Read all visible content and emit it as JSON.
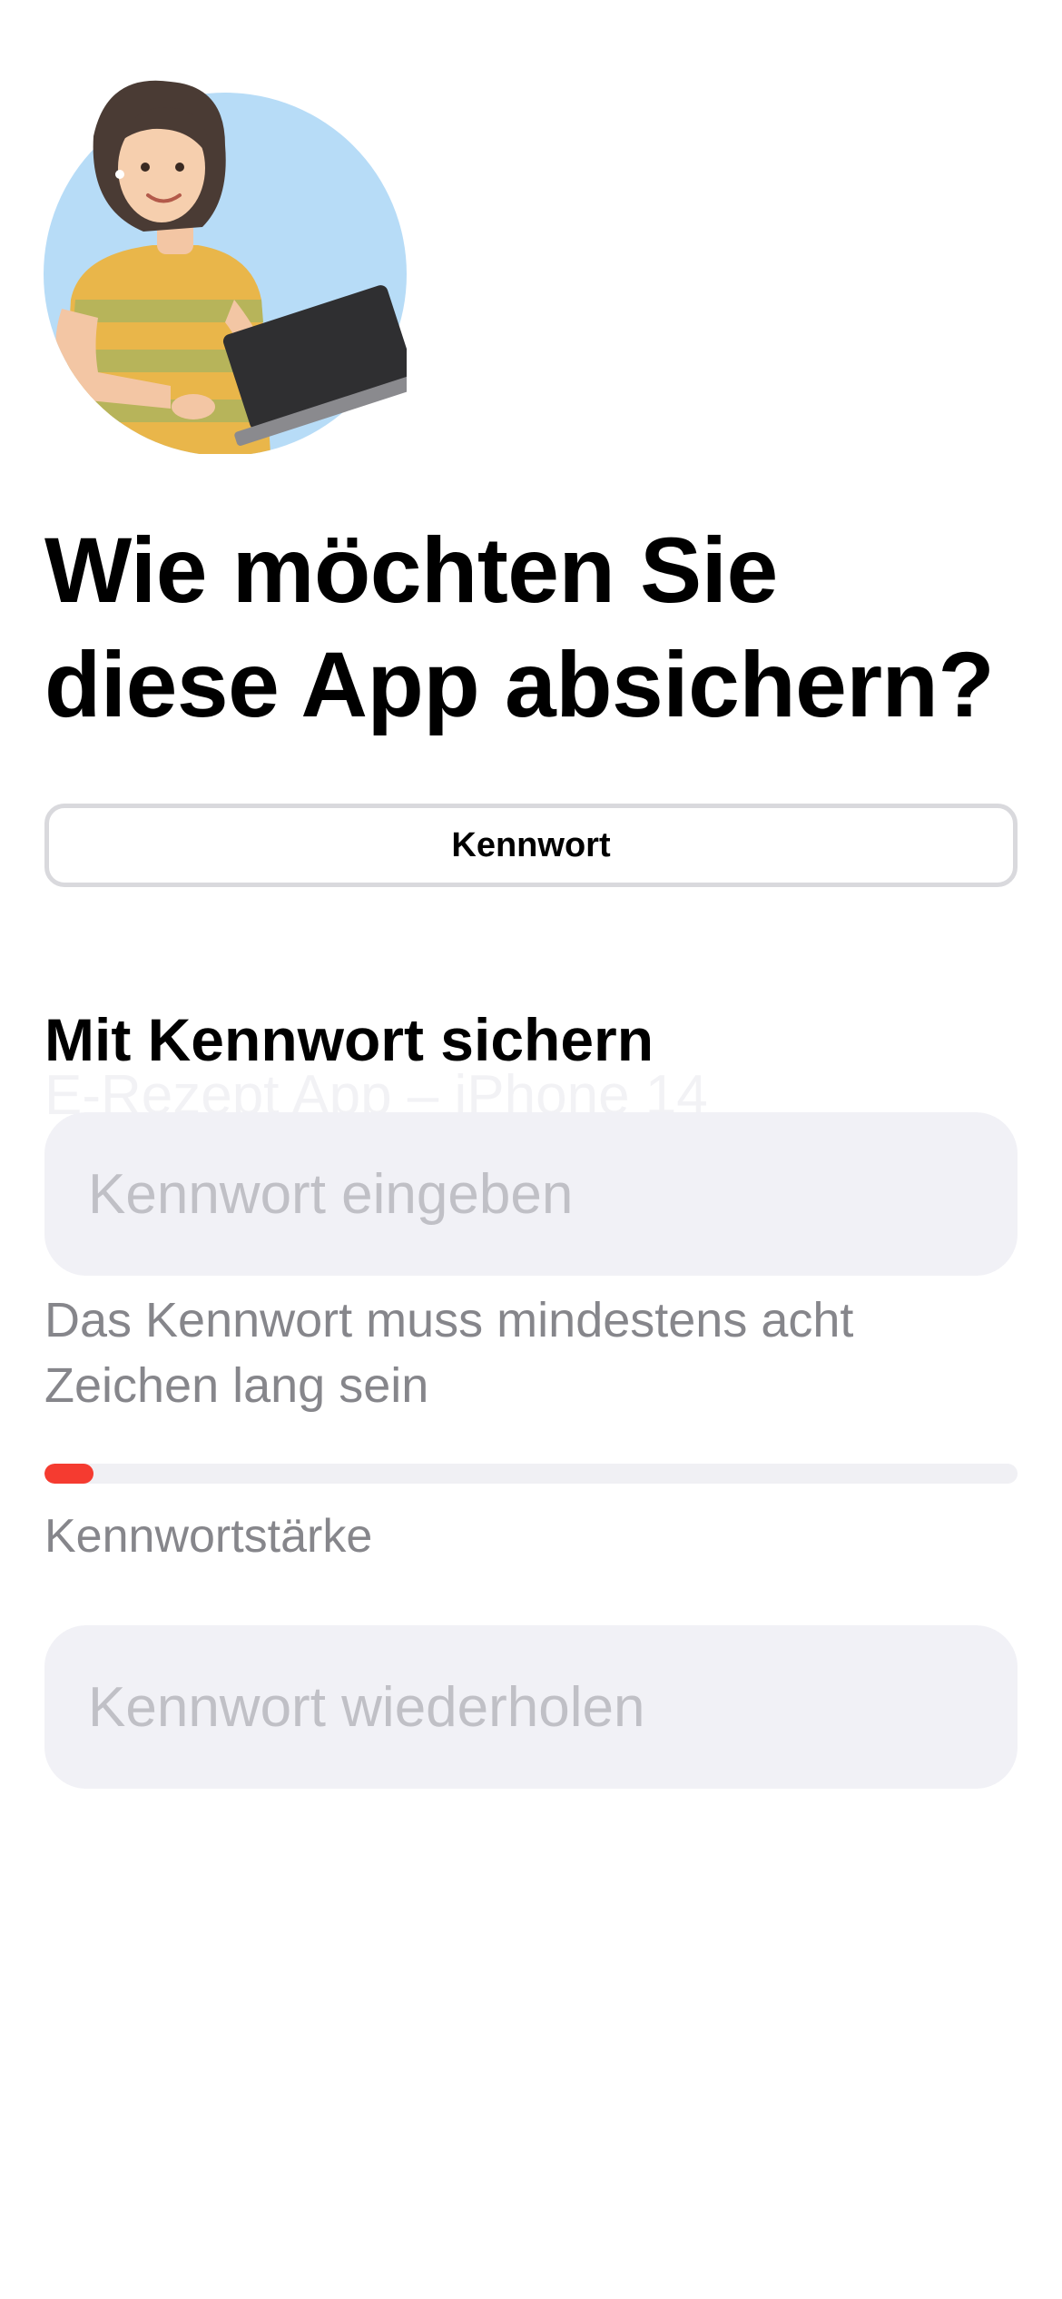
{
  "illustration": {
    "icon": "woman-with-laptop-illustration",
    "circle_color": "#b7dcf7"
  },
  "header": {
    "title": "Wie möchten Sie diese App absichern?"
  },
  "segmented_control": {
    "selected_label": "Kennwort"
  },
  "form": {
    "section_title": "Mit Kennwort sichern",
    "device_name": "E-Rezept App – iPhone 14",
    "password_placeholder": "Kennwort eingeben",
    "password_value": "",
    "hint": "Das Kennwort muss mindestens acht Zeichen lang sein",
    "strength_label": "Kennwortstärke",
    "strength_fraction": 0.05,
    "strength_color": "#f53b30",
    "repeat_placeholder": "Kennwort wiederholen",
    "repeat_value": ""
  }
}
